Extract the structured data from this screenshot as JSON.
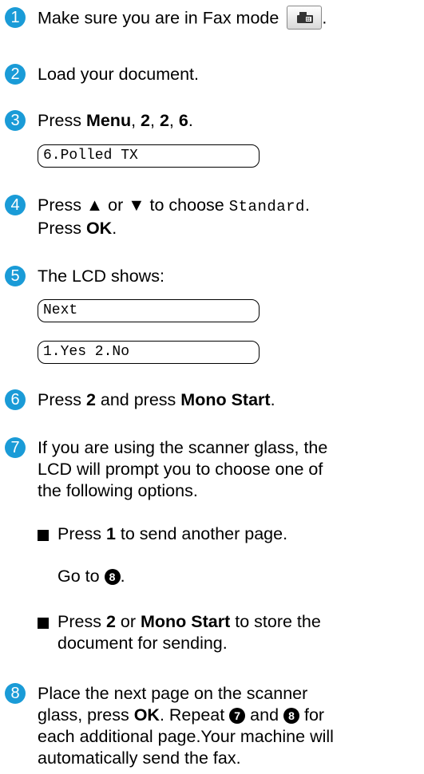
{
  "steps": [
    {
      "n": "1",
      "text": "Make sure you are in Fax mode",
      "tail": "."
    },
    {
      "n": "2",
      "text": "Load your document."
    },
    {
      "n": "3",
      "a": "Press ",
      "b1": "Menu",
      "c": ", ",
      "b2": "2",
      "d": ", ",
      "b3": "2",
      "e": ", ",
      "b4": "6",
      "f": "."
    },
    {
      "n": "4",
      "a": "Press ▲ or ▼ to choose ",
      "mono": "Standard",
      "b": ".",
      "line2a": "Press ",
      "line2b": "OK",
      "line2c": "."
    },
    {
      "n": "5",
      "text": "The LCD shows:"
    },
    {
      "n": "6",
      "a": "Press ",
      "b1": "2",
      "c": " and press ",
      "b2": "Mono Start",
      "d": "."
    },
    {
      "n": "7",
      "line1": "If you are using the scanner glass, the",
      "line2": "LCD will prompt you to choose one of",
      "line3": "the following options."
    },
    {
      "n": "8",
      "line1a": "Place the next page on the scanner",
      "line2a": "glass, press ",
      "line2b": "OK",
      "line2c": ". Repeat ",
      "line2d": " and ",
      "line2e": " for",
      "line3": "each additional page.Your machine will",
      "line4": "automatically send the fax."
    }
  ],
  "lcd": {
    "polled": "6.Polled TX",
    "next": "Next",
    "yesno": "1.Yes 2.No"
  },
  "bullets": [
    {
      "a": "Press ",
      "b": "1",
      "c": " to send another page.",
      "goto_a": "Go to ",
      "goto_ref": "8",
      "goto_b": "."
    },
    {
      "a": "Press ",
      "b1": "2",
      "c": " or ",
      "b2": "Mono Start",
      "d": " to store the",
      "line2": "document for sending."
    }
  ],
  "refs": {
    "seven": "7",
    "eight": "8"
  },
  "icons": {
    "fax_mode_button": "fax-icon"
  },
  "colors": {
    "step_number": "#1a9bd7"
  }
}
